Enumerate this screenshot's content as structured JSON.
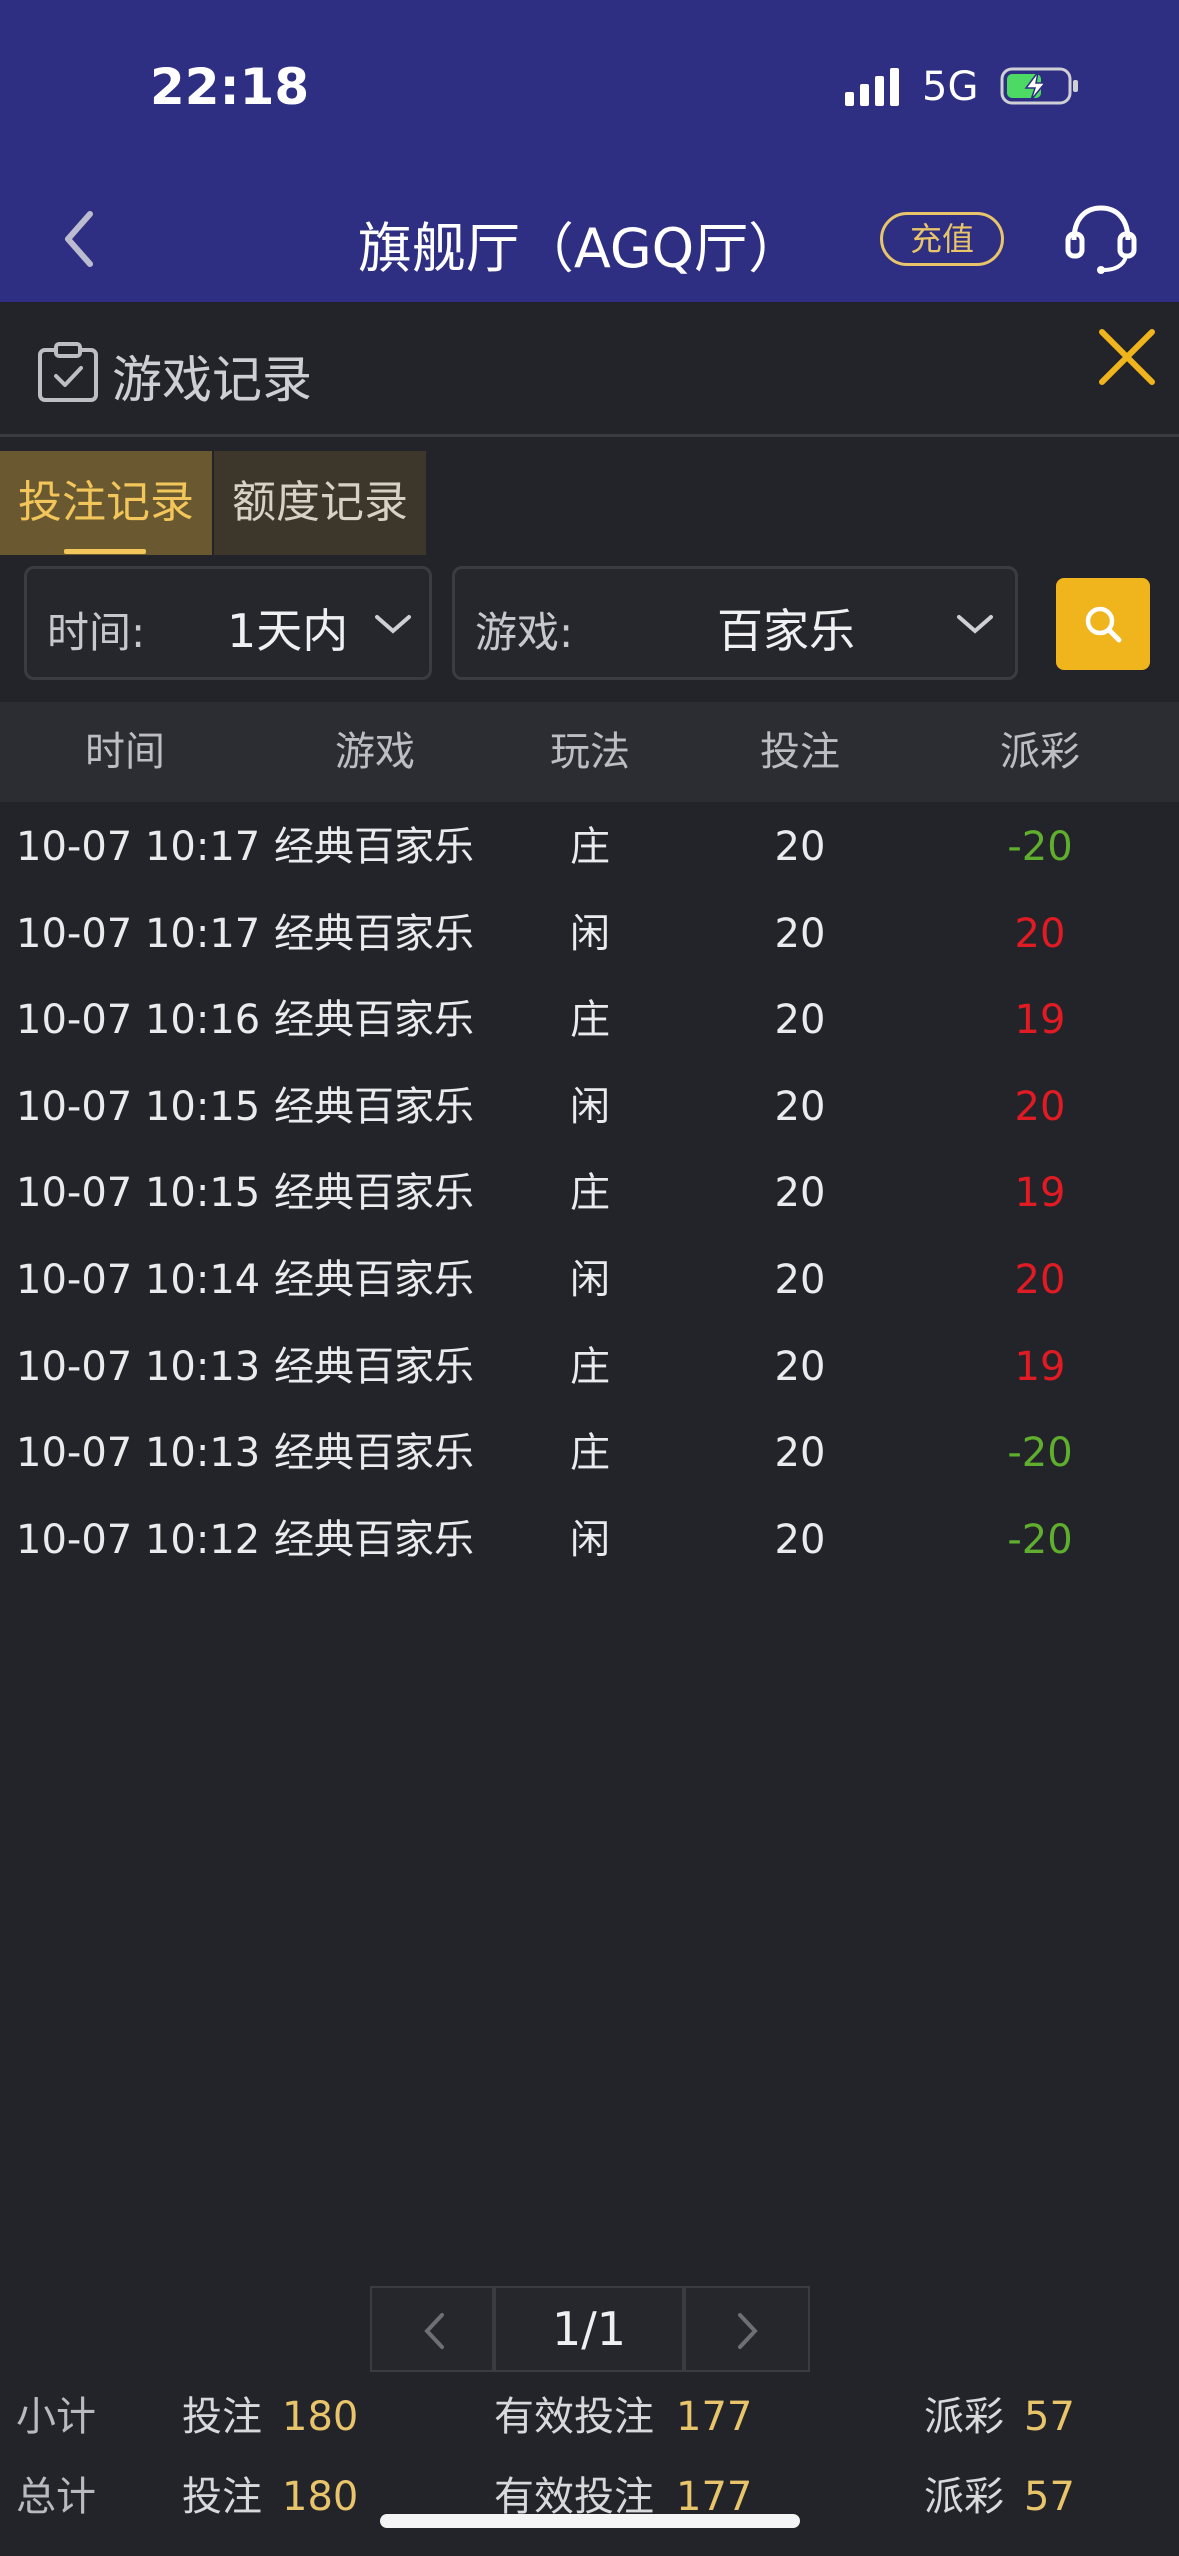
{
  "status_bar": {
    "time": "22:18",
    "network": "5G"
  },
  "nav": {
    "title": "旗舰厅（AGQ厅）",
    "recharge_label": "充值"
  },
  "panel": {
    "title": "游戏记录"
  },
  "tabs": [
    {
      "label": "投注记录",
      "active": true
    },
    {
      "label": "额度记录",
      "active": false
    }
  ],
  "filters": {
    "time": {
      "label": "时间:",
      "value": "1天内"
    },
    "game": {
      "label": "游戏:",
      "value": "百家乐"
    }
  },
  "table": {
    "headers": [
      "时间",
      "游戏",
      "玩法",
      "投注",
      "派彩"
    ],
    "rows": [
      {
        "time": "10-07 10:17",
        "game": "经典百家乐",
        "play": "庄",
        "bet": "20",
        "payout": "-20"
      },
      {
        "time": "10-07 10:17",
        "game": "经典百家乐",
        "play": "闲",
        "bet": "20",
        "payout": "20"
      },
      {
        "time": "10-07 10:16",
        "game": "经典百家乐",
        "play": "庄",
        "bet": "20",
        "payout": "19"
      },
      {
        "time": "10-07 10:15",
        "game": "经典百家乐",
        "play": "闲",
        "bet": "20",
        "payout": "20"
      },
      {
        "time": "10-07 10:15",
        "game": "经典百家乐",
        "play": "庄",
        "bet": "20",
        "payout": "19"
      },
      {
        "time": "10-07 10:14",
        "game": "经典百家乐",
        "play": "闲",
        "bet": "20",
        "payout": "20"
      },
      {
        "time": "10-07 10:13",
        "game": "经典百家乐",
        "play": "庄",
        "bet": "20",
        "payout": "19"
      },
      {
        "time": "10-07 10:13",
        "game": "经典百家乐",
        "play": "庄",
        "bet": "20",
        "payout": "-20"
      },
      {
        "time": "10-07 10:12",
        "game": "经典百家乐",
        "play": "闲",
        "bet": "20",
        "payout": "-20"
      }
    ]
  },
  "pagination": {
    "page": "1/1"
  },
  "summary": {
    "subtotal": {
      "label": "小计",
      "bet_label": "投注",
      "bet": "180",
      "effective_label": "有效投注",
      "effective": "177",
      "payout_label": "派彩",
      "payout": "57"
    },
    "total": {
      "label": "总计",
      "bet_label": "投注",
      "bet": "180",
      "effective_label": "有效投注",
      "effective": "177",
      "payout_label": "派彩",
      "payout": "57"
    }
  },
  "colors": {
    "nav_bg": "#2e2f82",
    "accent_gold": "#f0b41c",
    "loss_green": "#5fae2e",
    "win_red": "#e11b24"
  }
}
